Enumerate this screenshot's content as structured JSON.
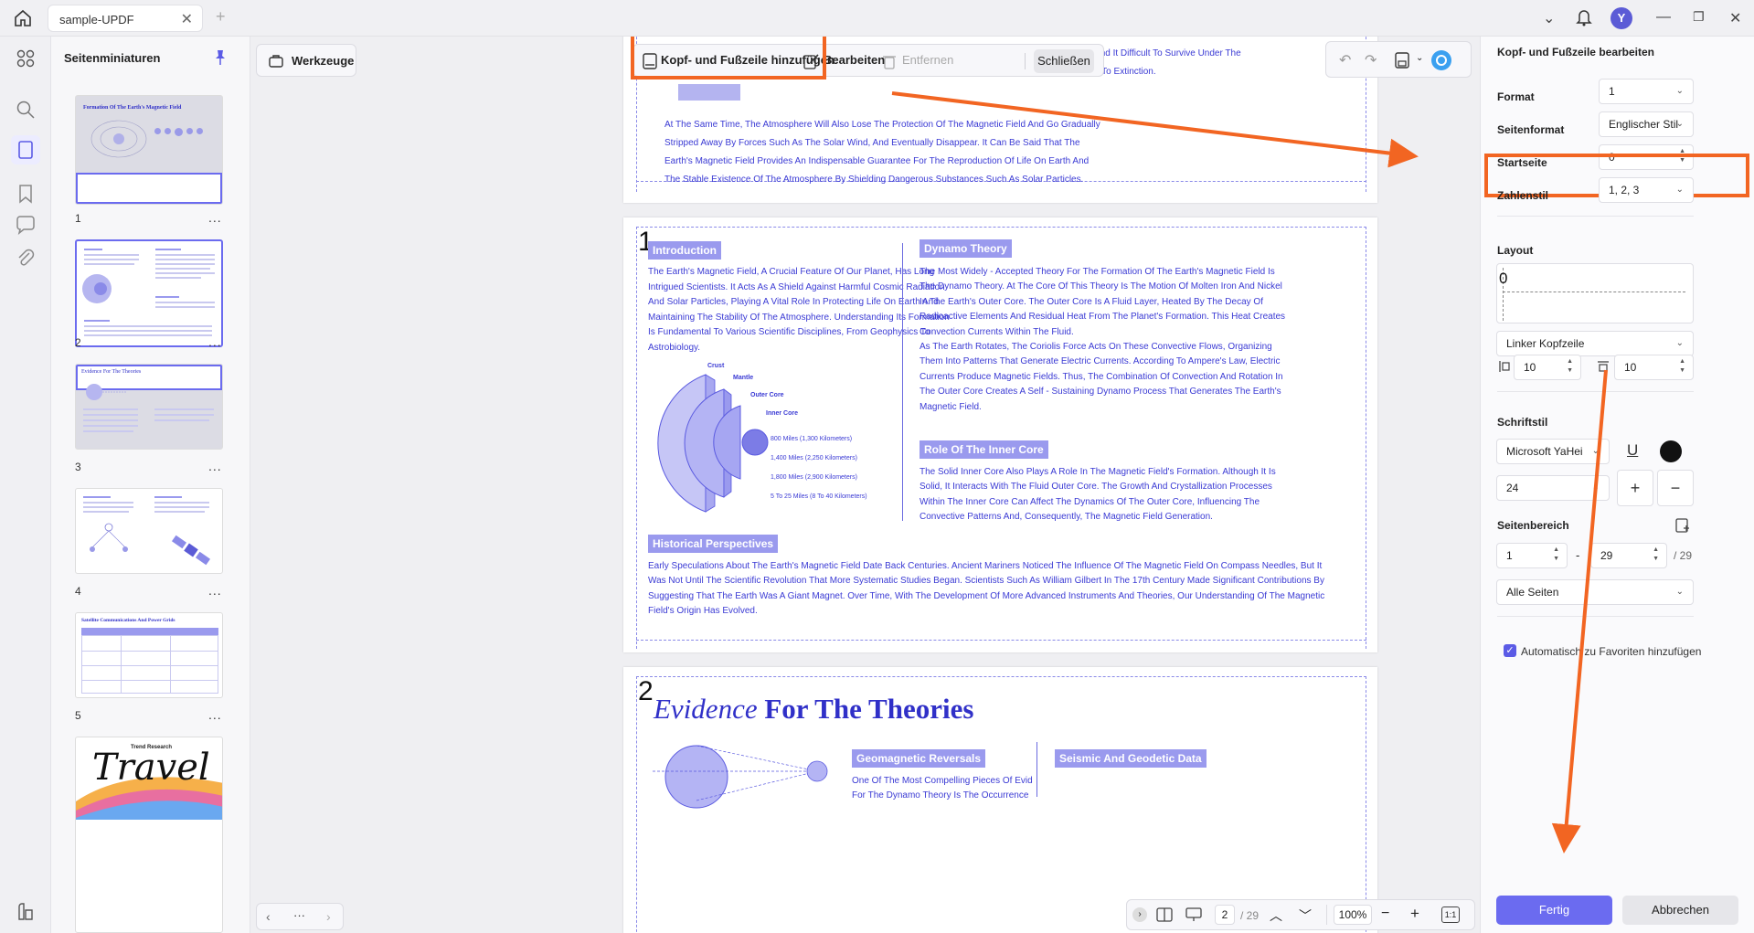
{
  "titlebar": {
    "tab_title": "sample-UPDF",
    "avatar_initial": "Y"
  },
  "thumbnails": {
    "title": "Seitenminiaturen",
    "pages": [
      {
        "num": "1",
        "title": "Formation Of The Earth's Magnetic Field"
      },
      {
        "num": "2"
      },
      {
        "num": "3",
        "title": "Evidence For The Theories"
      },
      {
        "num": "4"
      },
      {
        "num": "5",
        "title": "Satellite Communications And Power Grids"
      },
      {
        "num": "",
        "title": "Travel",
        "subtitle": "Trend Research"
      }
    ],
    "more": "..."
  },
  "toolbar": {
    "tools_label": "Werkzeuge",
    "add_header_footer": "Kopf- und Fußzeile hinzufügen",
    "edit": "Bearbeiten",
    "remove": "Entfernen",
    "close": "Schließen"
  },
  "document": {
    "page0_text": [
      "At The Same Time, The Atmosphere Will Also Lose The Protection Of The Magnetic Field And Go Gradually",
      "Stripped Away By Forces Such As The Solar Wind, And Eventually Disappear. It Can Be Said That The",
      "Earth's Magnetic Field Provides An Indispensable Guarantee For The Reproduction Of Life On Earth And",
      "The Stable Existence Of The Atmosphere By Shielding Dangerous Substances Such As Solar Particles."
    ],
    "page0_top_line": "Animals Or Tiny Microorganisms, Will Find It Difficult To Survive Under The",
    "page0_top_line2": "ys And Will Quickly Go To Extinction.",
    "page1_number": "1",
    "intro_heading": "Introduction",
    "intro_text": [
      "The Earth's Magnetic Field, A Crucial Feature Of Our Planet, Has Long",
      "Intrigued Scientists. It Acts As A Shield Against Harmful Cosmic Radiation",
      "And Solar Particles, Playing A Vital Role In Protecting Life On Earth And",
      "Maintaining The Stability Of The Atmosphere. Understanding Its Formation",
      "Is Fundamental To Various Scientific Disciplines, From Geophysics To",
      "Astrobiology."
    ],
    "diagram_labels": {
      "crust": "Crust",
      "mantle": "Mantle",
      "outer_core": "Outer Core",
      "inner_core": "Inner Core",
      "d1": "800 Miles (1,300 Kilometers)",
      "d2": "1,400 Miles (2,250 Kilometers)",
      "d3": "1,800 Miles (2,900 Kilometers)",
      "d4": "5 To 25 Miles (8 To 40 Kilometers)"
    },
    "dynamo_heading": "Dynamo Theory",
    "dynamo_text": [
      "The Most Widely - Accepted Theory For The Formation Of The Earth's Magnetic Field Is",
      "The Dynamo Theory. At The Core Of This Theory Is The Motion Of Molten Iron And Nickel",
      "In The Earth's Outer Core. The Outer Core Is A Fluid Layer, Heated By The Decay Of",
      "Radioactive Elements And Residual Heat From The Planet's Formation. This Heat Creates",
      "Convection Currents Within The Fluid.",
      "As The Earth Rotates, The Coriolis Force Acts On These Convective Flows, Organizing",
      "Them Into Patterns That Generate Electric Currents. According To Ampere's Law, Electric",
      "Currents Produce Magnetic Fields. Thus, The Combination Of Convection And Rotation In",
      "The Outer Core Creates A Self - Sustaining Dynamo Process That Generates The Earth's",
      "Magnetic Field."
    ],
    "inner_core_heading": "Role Of The Inner Core",
    "inner_core_text": [
      "The Solid Inner Core Also Plays A Role In The Magnetic Field's Formation. Although It Is",
      "Solid, It Interacts With The Fluid Outer Core. The Growth And Crystallization Processes",
      "Within The Inner Core Can Affect The Dynamics Of The Outer Core, Influencing The",
      "Convective Patterns And, Consequently, The Magnetic Field Generation."
    ],
    "historical_heading": "Historical Perspectives",
    "historical_text": [
      "Early Speculations About The Earth's Magnetic Field Date Back Centuries. Ancient Mariners Noticed The Influence Of The Magnetic Field On Compass Needles, But It",
      "Was Not Until The Scientific Revolution That More Systematic Studies Began. Scientists Such As William Gilbert In The 17th Century Made Significant Contributions By",
      "Suggesting That The Earth Was A Giant Magnet. Over Time, With The Development Of More Advanced Instruments And Theories, Our Understanding Of The Magnetic",
      "Field's Origin Has Evolved."
    ],
    "page2_number": "2",
    "evidence_title_italic": "Evidence",
    "evidence_title_bold": "For The Theories",
    "geo_heading": "Geomagnetic Reversals",
    "geo_text": [
      "One Of The Most Compelling Pieces Of Evid",
      "For The Dynamo Theory Is The Occurrence"
    ],
    "seismic_heading": "Seismic And Geodetic Data"
  },
  "status": {
    "current_page": "2",
    "total_pages": "/ 29",
    "zoom": "100%"
  },
  "panel": {
    "title": "Kopf- und Fußzeile bearbeiten",
    "format_label": "Format",
    "format_value": "1",
    "pageformat_label": "Seitenformat",
    "pageformat_value": "Englischer Stil",
    "startpage_label": "Startseite",
    "startpage_value": "0",
    "numstyle_label": "Zahlenstil",
    "numstyle_value": "1, 2, 3",
    "layout_label": "Layout",
    "layout_preview": "0",
    "position_value": "Linker Kopfzeile",
    "margin_left": "10",
    "margin_top": "10",
    "font_label": "Schriftstil",
    "font_value": "Microsoft YaHei",
    "font_size": "24",
    "range_label": "Seitenbereich",
    "range_from": "1",
    "range_dash": "-",
    "range_to": "29",
    "range_total": "/ 29",
    "pages_select": "Alle Seiten",
    "favorites_label": "Automatisch zu Favoriten hinzufügen",
    "done": "Fertig",
    "cancel": "Abbrechen"
  },
  "colors": {
    "accent": "#6b6bf0",
    "highlight": "#f26522",
    "doc_text": "#3a3ad4",
    "tag_bg": "#9a9aee"
  }
}
